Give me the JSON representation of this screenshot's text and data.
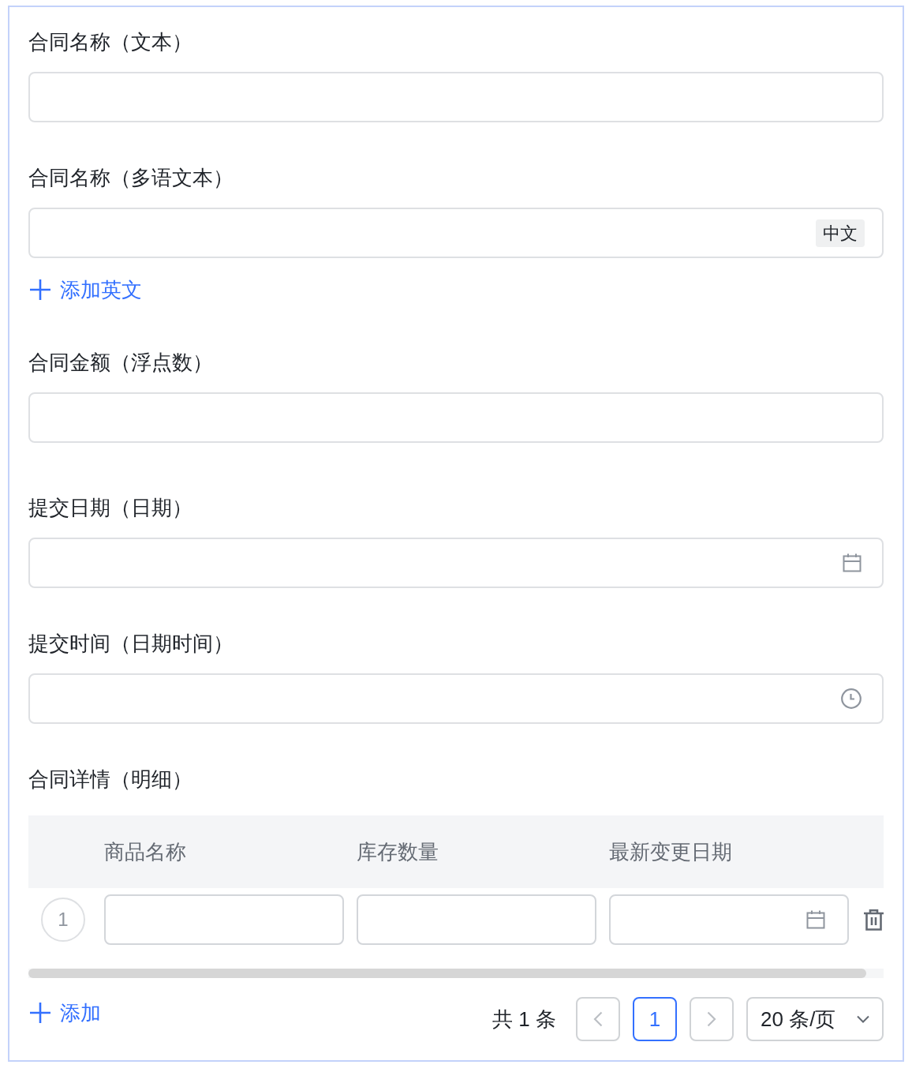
{
  "fields": [
    {
      "kind": "text",
      "label": "合同名称（文本）"
    },
    {
      "kind": "multilang",
      "label": "合同名称（多语文本）",
      "language_tag": "中文",
      "add_link": "添加英文"
    },
    {
      "kind": "number",
      "label": "合同金额（浮点数）"
    },
    {
      "kind": "date",
      "label": "提交日期（日期）"
    },
    {
      "kind": "datetime",
      "label": "提交时间（日期时间）"
    }
  ],
  "detail": {
    "label": "合同详情（明细）",
    "columns": [
      {
        "title": "商品名称",
        "kind": "text"
      },
      {
        "title": "库存数量",
        "kind": "number"
      },
      {
        "title": "最新变更日期",
        "kind": "date"
      }
    ],
    "rows": [
      {
        "index": "1"
      }
    ],
    "add_button": "添加",
    "pagination": {
      "total": "共 1 条",
      "prev": {
        "disabled": true
      },
      "pages": [
        {
          "label": "1",
          "selected": true
        }
      ],
      "next": {
        "disabled": true
      },
      "page_size": "20 条/页"
    }
  }
}
